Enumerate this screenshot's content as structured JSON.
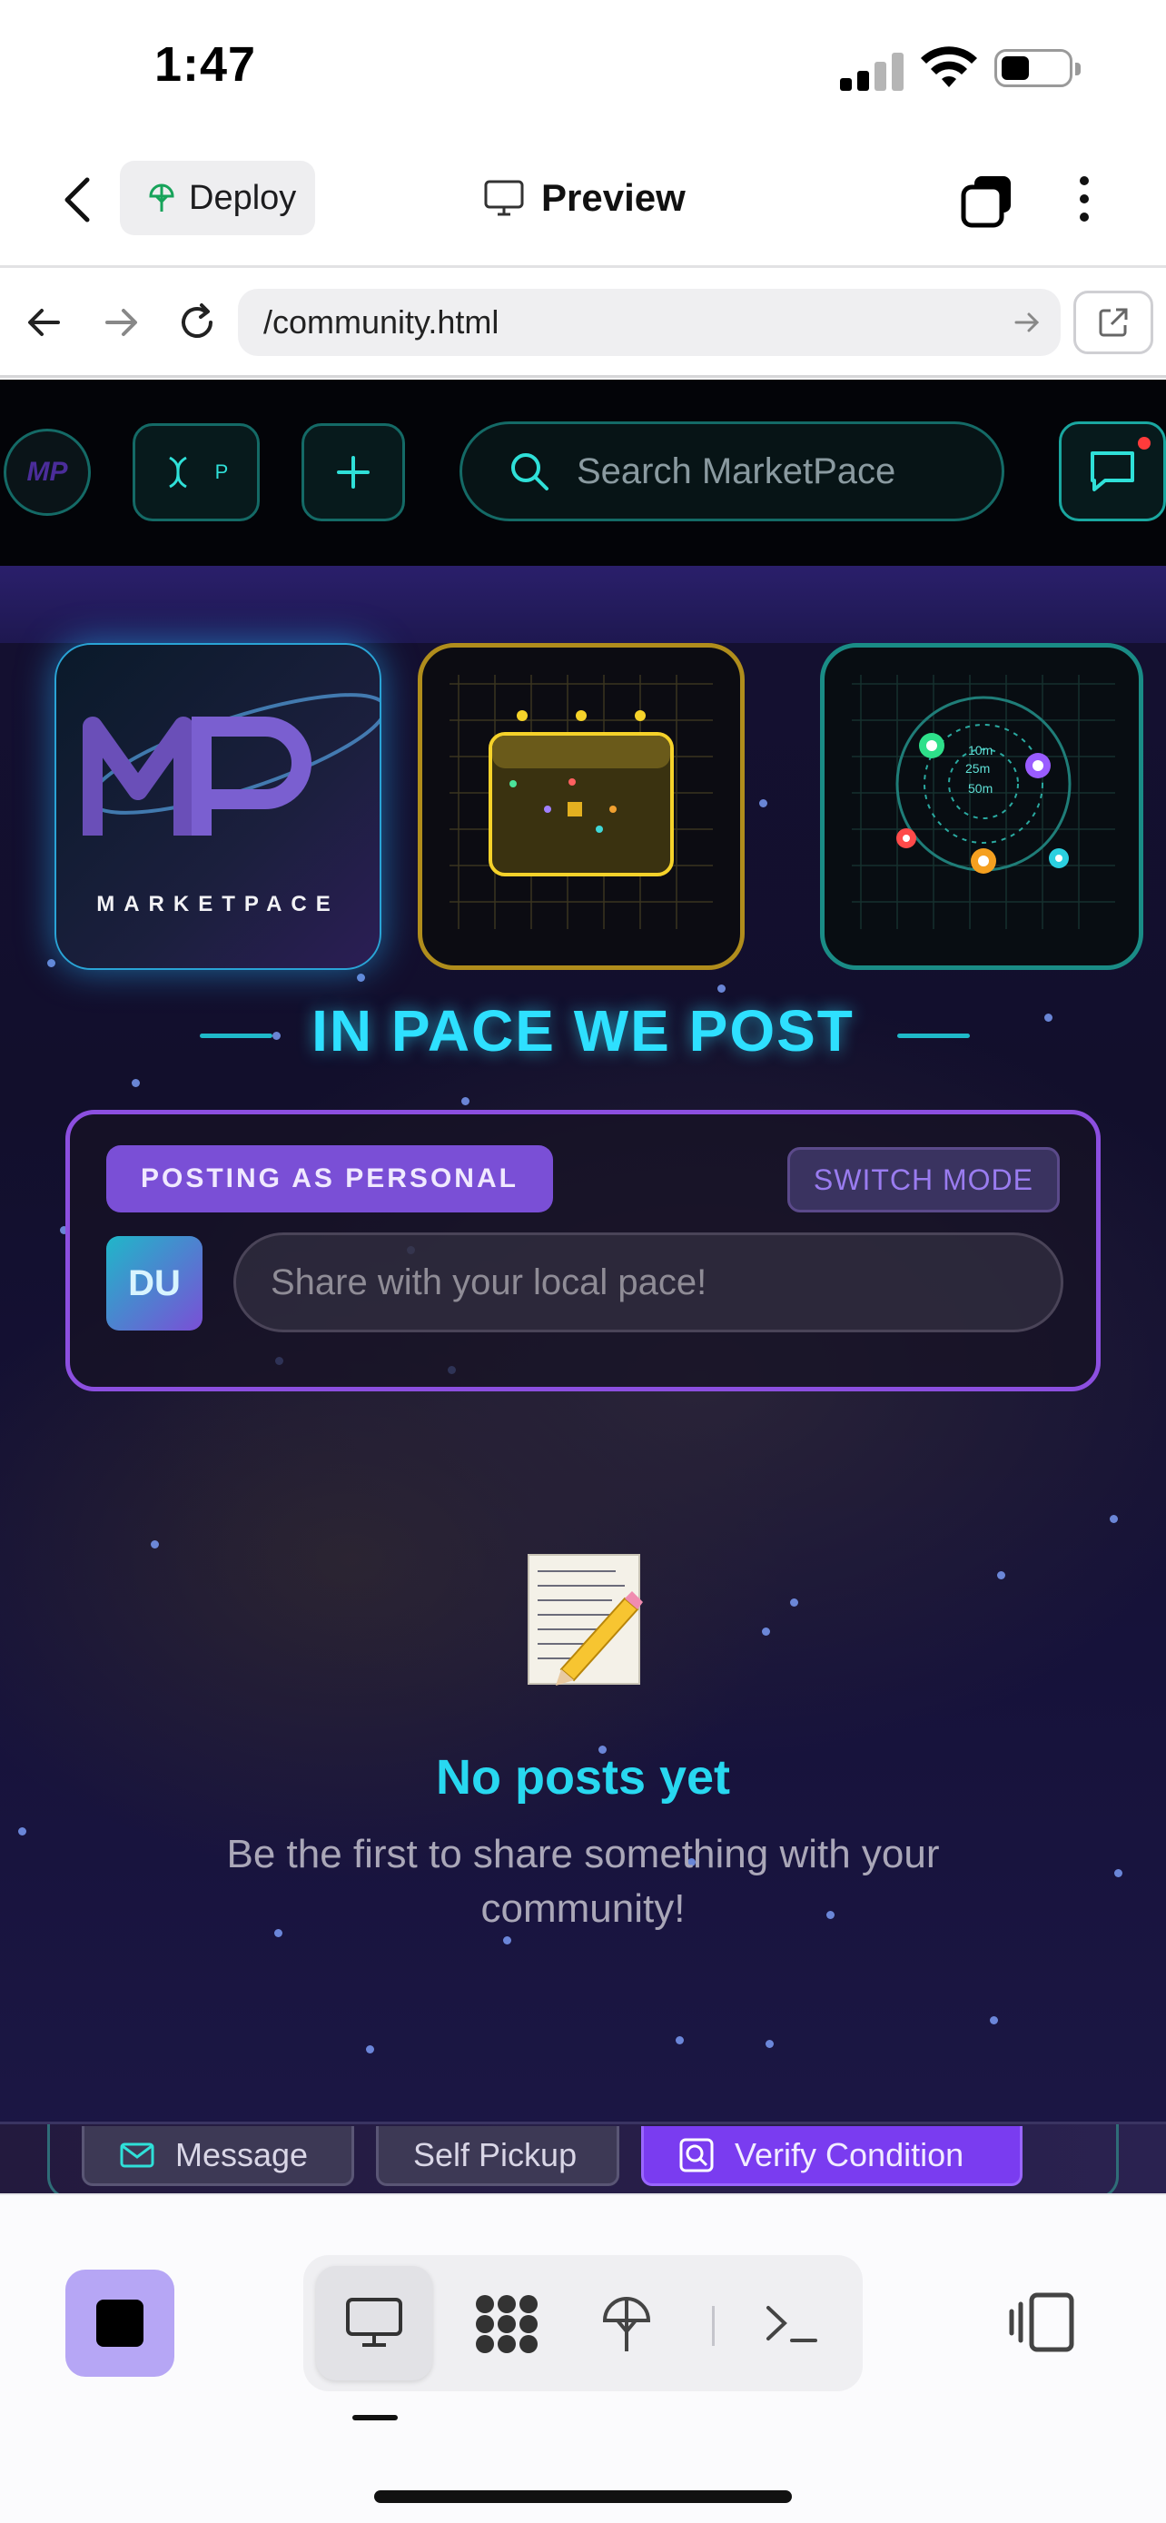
{
  "status_bar": {
    "time": "1:47"
  },
  "app_header": {
    "deploy_label": "Deploy",
    "title": "Preview"
  },
  "url_bar": {
    "url": "/community.html"
  },
  "site": {
    "nav": {
      "avatar_initials": "MP",
      "tile_letter": "P",
      "search_placeholder": "Search MarketPace"
    },
    "logo_wordmark": "MARKETPACE",
    "headline": "IN PACE WE POST",
    "composer": {
      "mode_badge": "POSTING AS PERSONAL",
      "switch_mode": "SWITCH MODE",
      "avatar_initials": "DU",
      "input_placeholder": "Share with your local pace!"
    },
    "empty_state": {
      "title": "No posts yet",
      "subtitle": "Be the first to share something with your community!"
    },
    "bottom_actions": {
      "message": "Message",
      "self_pickup": "Self Pickup",
      "verify_condition": "Verify Condition"
    },
    "radar_labels": [
      "10m",
      "25m",
      "50m"
    ],
    "colors": {
      "accent_cyan": "#2ee0ff",
      "accent_purple": "#7a4fd6",
      "teal_border": "#146a66",
      "verify_purple": "#7a3cf0"
    }
  },
  "toolbar": {
    "icons": [
      "stop-icon",
      "desktop-preview-icon",
      "apps-grid-icon",
      "deploy-icon",
      "terminal-icon",
      "side-panel-icon"
    ]
  }
}
